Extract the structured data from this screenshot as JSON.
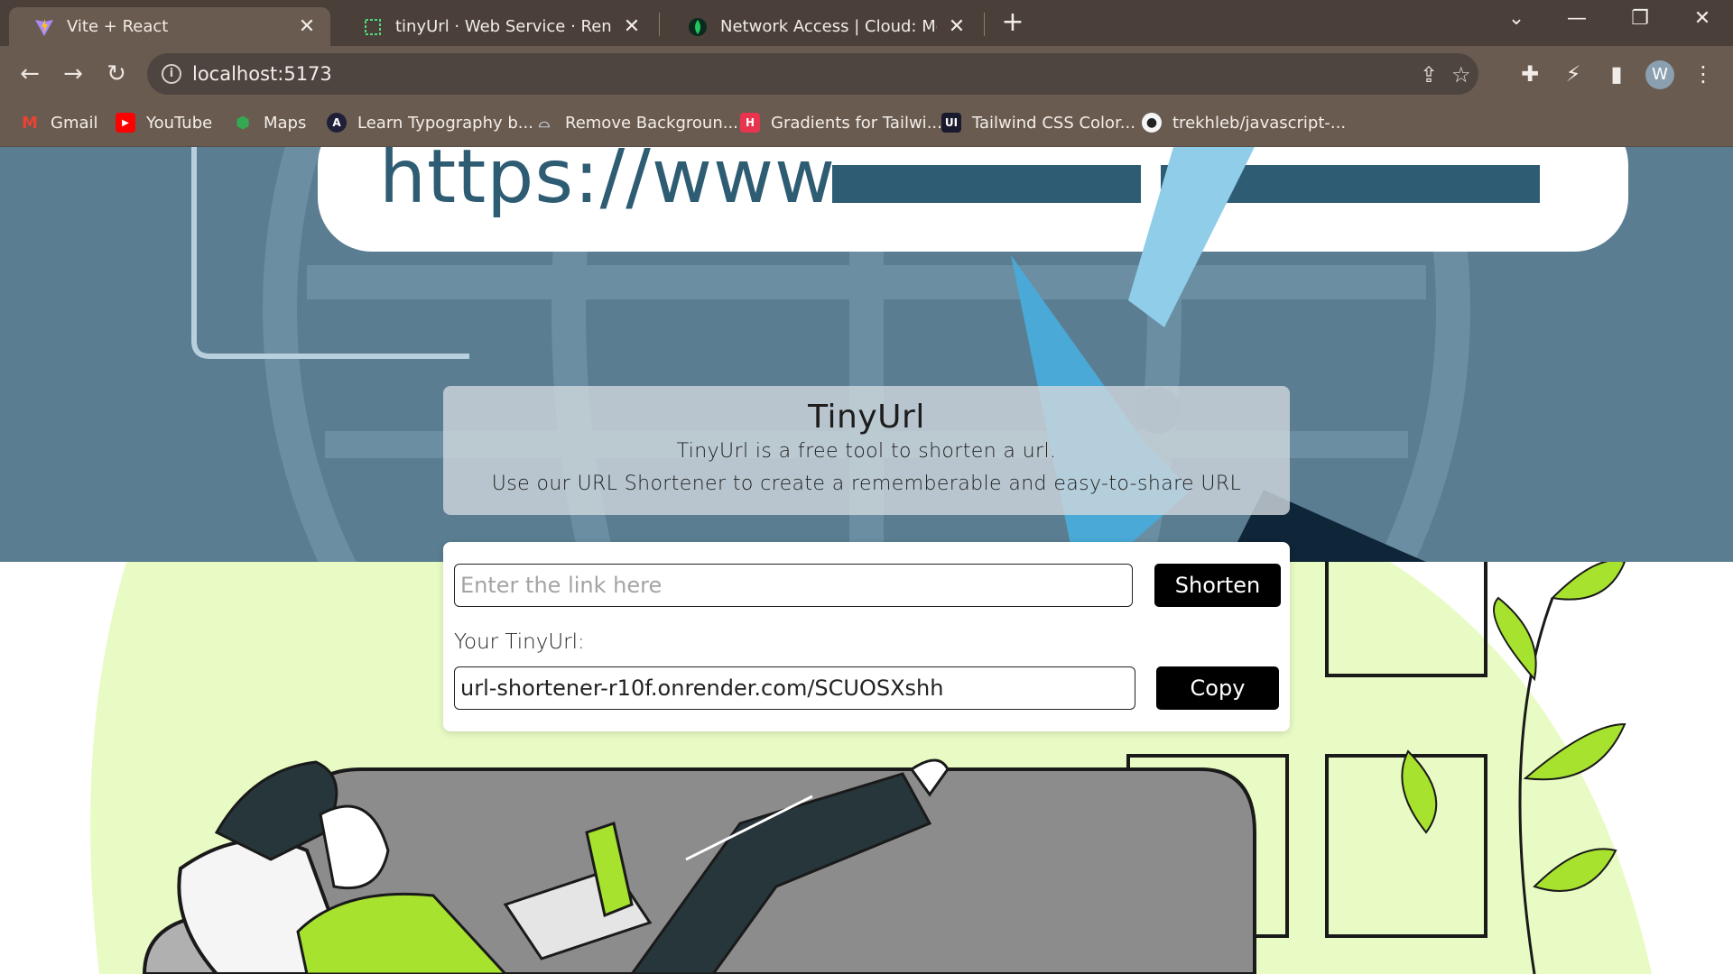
{
  "browser": {
    "tabs": [
      {
        "title": "Vite + React",
        "active": true,
        "icon": "vite-icon"
      },
      {
        "title": "tinyUrl · Web Service · Render D",
        "active": false,
        "icon": "render-icon"
      },
      {
        "title": "Network Access | Cloud: MongoD",
        "active": false,
        "icon": "mongodb-leaf-icon"
      }
    ],
    "address": "localhost:5173",
    "bookmarks": [
      {
        "label": "Gmail",
        "icon": "gmail-icon",
        "color": "#ea4335"
      },
      {
        "label": "YouTube",
        "icon": "youtube-icon",
        "color": "#ff0000"
      },
      {
        "label": "Maps",
        "icon": "maps-icon",
        "color": "#34a853"
      },
      {
        "label": "Learn Typography b...",
        "icon": "typography-icon",
        "color": "#1f1f3a"
      },
      {
        "label": "Remove Backgroun...",
        "icon": "remove-bg-icon",
        "color": "#8aa0c0"
      },
      {
        "label": "Gradients for Tailwi...",
        "icon": "hypercolor-icon",
        "color": "#e8344e"
      },
      {
        "label": "Tailwind CSS Color...",
        "icon": "ui-icon",
        "color": "#1a1a2e"
      },
      {
        "label": "trekhleb/javascript-...",
        "icon": "github-icon",
        "color": "#222222"
      }
    ],
    "profile_initial": "W"
  },
  "hero": {
    "url_art_text": "https://www"
  },
  "info": {
    "title": "TinyUrl",
    "line1": "TinyUrl is a free tool to shorten a url.",
    "line2": "Use our URL Shortener to create a rememberable and easy-to-share URL"
  },
  "form": {
    "input_placeholder": "Enter the link here",
    "input_value": "",
    "shorten_label": "Shorten",
    "result_label": "Your TinyUrl:",
    "result_value": "url-shortener-r10f.onrender.com/SCUOSXshh",
    "copy_label": "Copy"
  },
  "colors": {
    "hero_bg": "#5b7d91",
    "accent_lime": "#a6e22e",
    "button_bg": "#000000"
  }
}
